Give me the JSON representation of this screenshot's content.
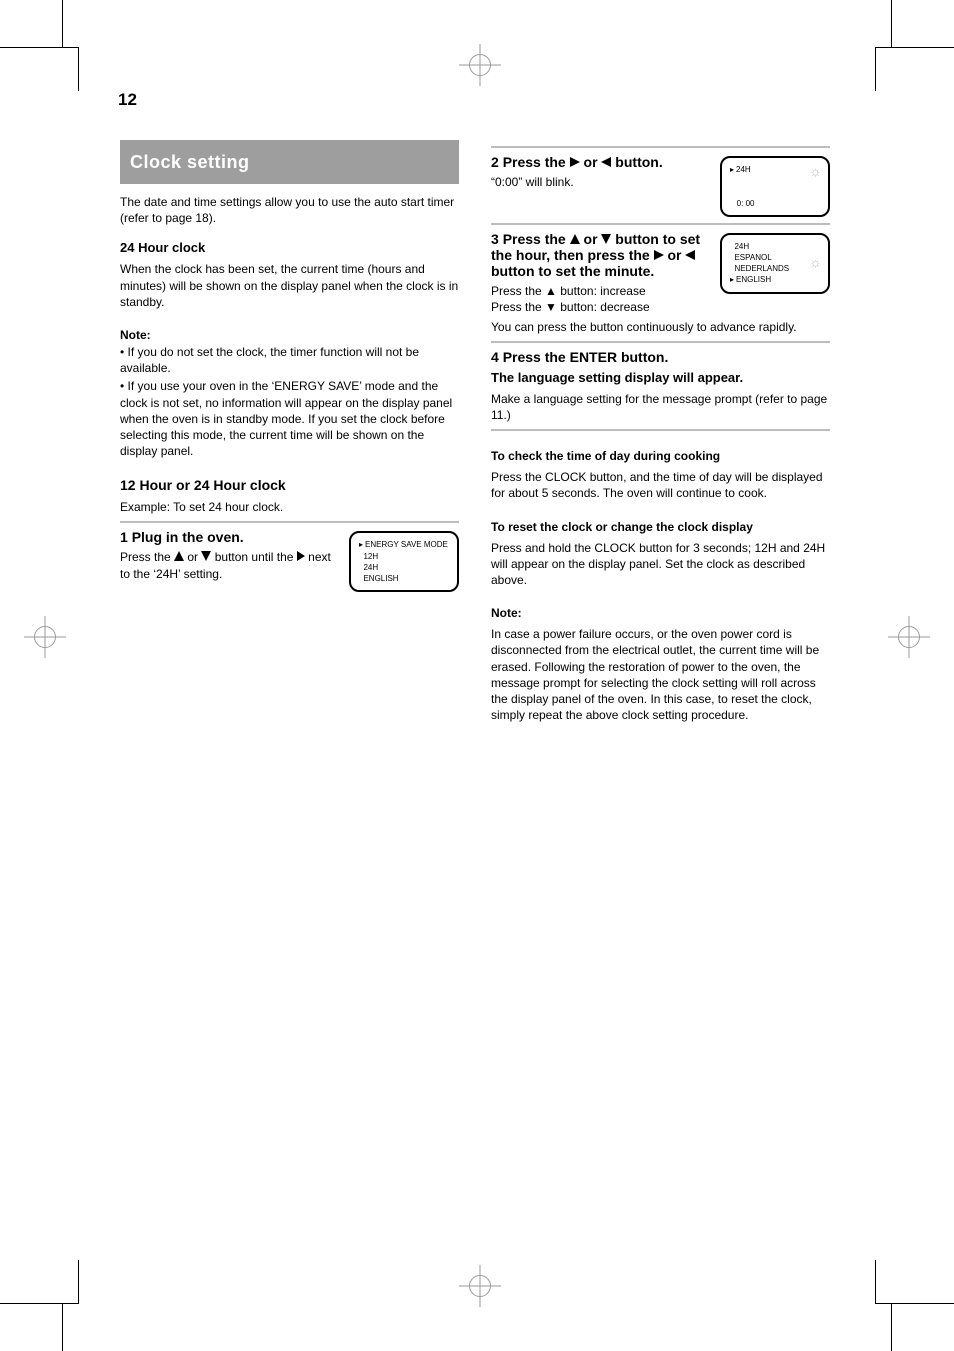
{
  "page_number": "12",
  "section_title": "Clock setting",
  "intro_1": "The date and time settings allow you to use the auto start timer (refer to page 18).",
  "intro_2_label": "24 Hour clock",
  "intro_2_text": "When the clock has been set, the current time (hours and minutes) will be shown on the display panel when the clock is in standby.",
  "notes_label": "Note:",
  "notes": [
    "If you do not set the clock, the timer function will not be available.",
    "If you use your oven in the ‘ENERGY SAVE’ mode and the clock is not set, no information will appear on the display panel when the oven is in standby mode. If you set the clock before selecting this mode, the current time will be shown on the display panel."
  ],
  "clock_heading": "12 Hour or 24 Hour clock",
  "clock_intro": "Example: To set 24 hour clock.",
  "step1": {
    "num": "1",
    "head": "Plug in the oven.",
    "screen": {
      "lines": [
        "ENERGY SAVE MODE",
        "12H",
        "24H",
        "ENGLISH"
      ],
      "pointer_on_line": 0
    },
    "body_parts": [
      "Press the ",
      "▲",
      " or ",
      "▼",
      " button until the ",
      "▶",
      " next to the ‘24H’ setting."
    ]
  },
  "step2": {
    "num": "2",
    "head_parts": [
      "Press the ",
      "▶",
      " or ",
      "◀",
      " button."
    ],
    "screen": {
      "lines": [
        "24H",
        "",
        "",
        "  0: 00"
      ],
      "pointer_on_line": 0,
      "sun_line": 0
    },
    "tail": "“0:00” will blink."
  },
  "step3": {
    "num": "3",
    "head_parts": [
      "Press the ",
      "▲",
      " or ",
      "▼",
      " button to set the hour, then press the ",
      "▶",
      " or ",
      "◀",
      " button to set the minute."
    ],
    "screen": {
      "lines": [
        "24H",
        "ESPANOL",
        "NEDERLANDS",
        "ENGLISH"
      ],
      "pointer_on_line": 3,
      "sun_line": 1
    },
    "substeps": [
      "Press the ▲ button: increase",
      "Press the ▼ button: decrease"
    ],
    "tip": "You can press the button continuously to advance rapidly."
  },
  "step4": {
    "num": "4",
    "head": "Press the ENTER button.",
    "sub": "The language setting display will appear.",
    "body": "Make a language setting for the message prompt (refer to page 11.)"
  },
  "check_label": "To check the time of day during cooking",
  "check_body": "Press the CLOCK button, and the time of day will be displayed for about 5 seconds. The oven will continue to cook.",
  "reset_label": "To reset the clock or change the clock display",
  "reset_body": "Press and hold the CLOCK button for 3 seconds; 12H and 24H will appear on the display panel. Set the clock as described above.",
  "final_note_label": "Note:",
  "final_note_body": "In case a power failure occurs, or the oven power cord is disconnected from the electrical outlet, the current time will be erased. Following the restoration of power to the oven, the message prompt for selecting the clock setting will roll across the display panel of the oven. In this case, to reset the clock, simply repeat the above clock setting procedure."
}
